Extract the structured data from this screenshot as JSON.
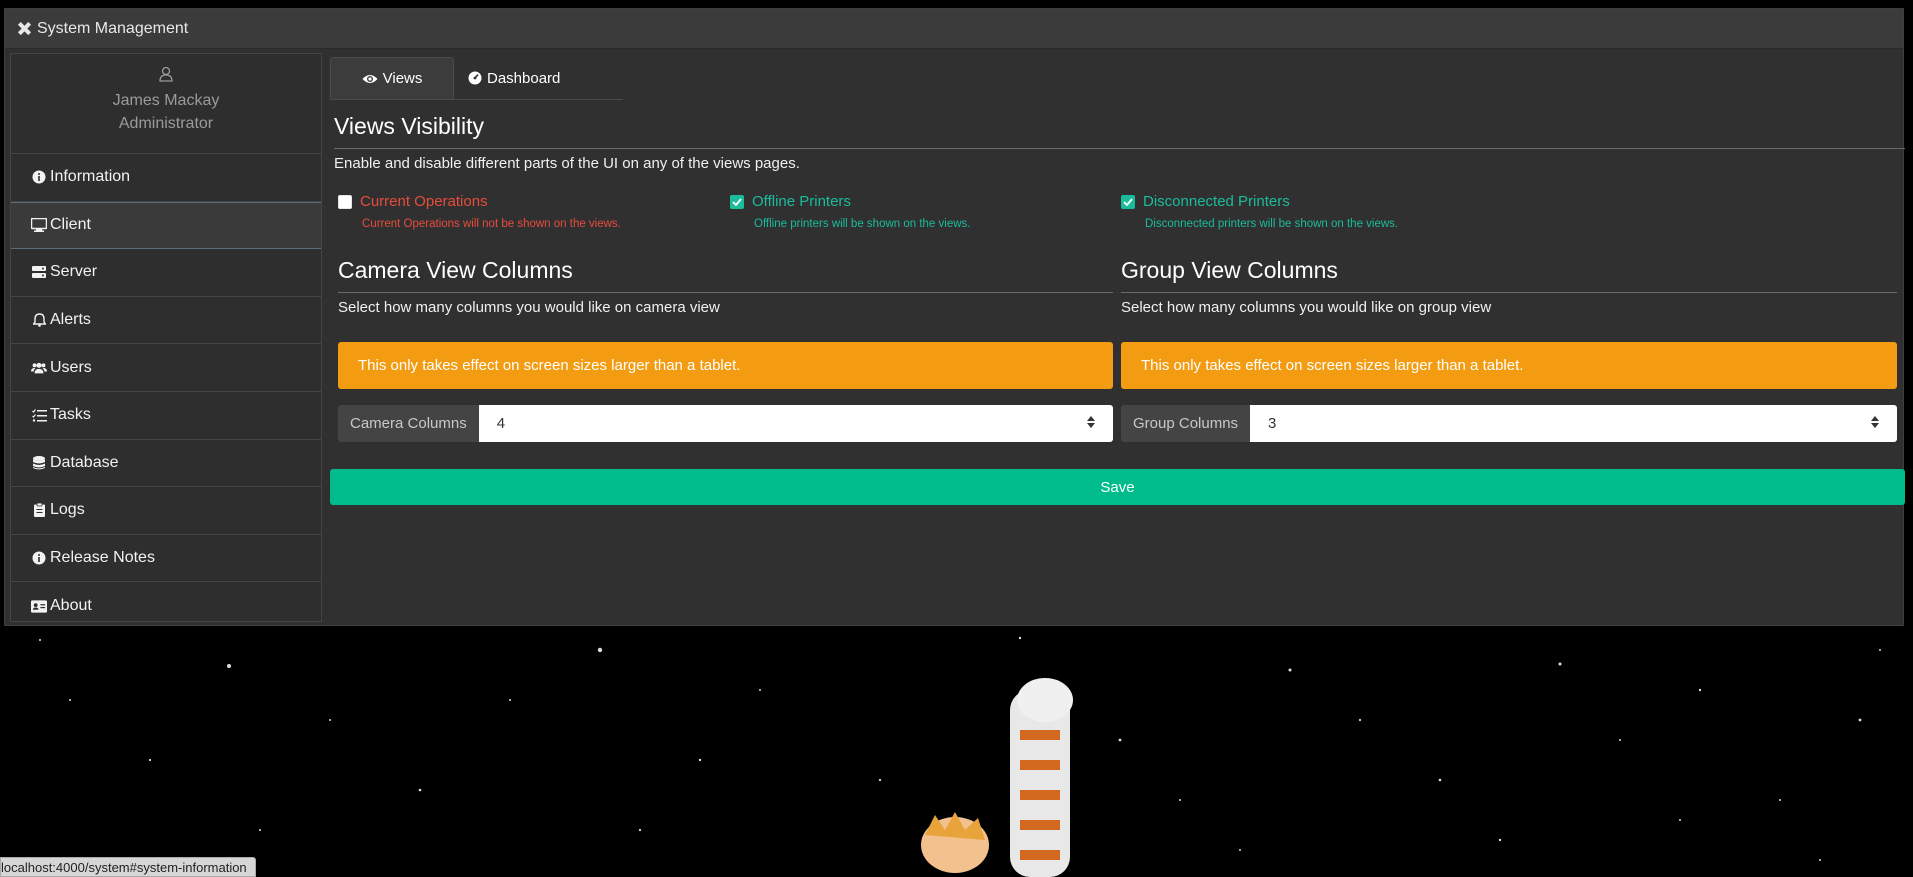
{
  "window": {
    "title": "System Management",
    "icon": "tools-icon"
  },
  "user": {
    "name": "James Mackay",
    "role": "Administrator",
    "icon": "user-icon"
  },
  "sidebar": {
    "items": [
      {
        "label": "Information",
        "icon": "info-circle-icon"
      },
      {
        "label": "Client",
        "icon": "desktop-icon",
        "active": true
      },
      {
        "label": "Server",
        "icon": "server-icon"
      },
      {
        "label": "Alerts",
        "icon": "bell-icon"
      },
      {
        "label": "Users",
        "icon": "users-icon"
      },
      {
        "label": "Tasks",
        "icon": "tasks-icon"
      },
      {
        "label": "Database",
        "icon": "database-icon"
      },
      {
        "label": "Logs",
        "icon": "clipboard-icon"
      },
      {
        "label": "Release Notes",
        "icon": "info-circle-icon"
      },
      {
        "label": "About",
        "icon": "id-card-icon"
      }
    ]
  },
  "tabs": [
    {
      "label": "Views",
      "icon": "eye-icon",
      "active": true
    },
    {
      "label": "Dashboard",
      "icon": "gauge-icon"
    }
  ],
  "views_visibility": {
    "title": "Views Visibility",
    "description": "Enable and disable different parts of the UI on any of the views pages.",
    "options": [
      {
        "label": "Current Operations",
        "checked": false,
        "help": "Current Operations will not be shown on the views."
      },
      {
        "label": "Offline Printers",
        "checked": true,
        "help": "Offline printers will be shown on the views."
      },
      {
        "label": "Disconnected Printers",
        "checked": true,
        "help": "Disconnected printers will be shown on the views."
      }
    ]
  },
  "camera": {
    "title": "Camera View Columns",
    "description": "Select how many columns you would like on camera view",
    "alert": "This only takes effect on screen sizes larger than a tablet.",
    "label": "Camera Columns",
    "value": "4"
  },
  "group": {
    "title": "Group View Columns",
    "description": "Select how many columns you would like on group view",
    "alert": "This only takes effect on screen sizes larger than a tablet.",
    "label": "Group Columns",
    "value": "3"
  },
  "save_label": "Save",
  "status_url": "localhost:4000/system#system-information",
  "colors": {
    "accent": "#00bc8c",
    "warning": "#f39c12",
    "danger": "#e74c3c",
    "panel": "#303030"
  }
}
